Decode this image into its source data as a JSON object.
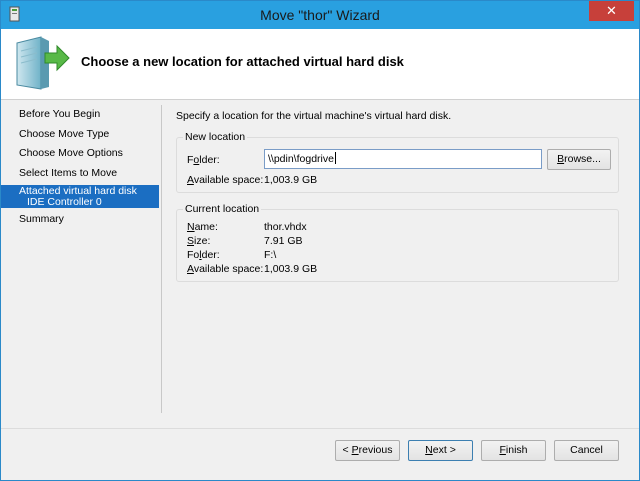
{
  "window": {
    "title": "Move \"thor\" Wizard",
    "close_glyph": "✕"
  },
  "header": {
    "title": "Choose a new location for attached virtual hard disk",
    "icon": "server-move-icon"
  },
  "nav": {
    "items": [
      {
        "label": "Before You Begin"
      },
      {
        "label": "Choose Move Type"
      },
      {
        "label": "Choose Move Options"
      },
      {
        "label": "Select Items to Move"
      },
      {
        "label": "Attached virtual hard disk",
        "sublabel": "IDE Controller 0",
        "selected": true
      },
      {
        "label": "Summary"
      }
    ]
  },
  "main": {
    "description": "Specify a location for the virtual machine's virtual hard disk.",
    "new_location": {
      "group_label": "New location",
      "folder_label_pre": "F",
      "folder_label_u": "o",
      "folder_label_post": "lder:",
      "folder_value": "\\\\pdin\\fogdrive",
      "browse_label_u": "B",
      "browse_label_post": "rowse...",
      "space_label_pre": "",
      "space_label_u": "A",
      "space_label_post": "vailable space:",
      "space_value": "1,003.9 GB"
    },
    "current_location": {
      "group_label": "Current location",
      "name_label_u": "N",
      "name_label_post": "ame:",
      "name_value": "thor.vhdx",
      "size_label_u": "S",
      "size_label_post": "ize:",
      "size_value": "7.91 GB",
      "folder_label_pre": "Fo",
      "folder_label_u": "l",
      "folder_label_post": "der:",
      "folder_value": "F:\\",
      "space_label_u": "A",
      "space_label_post": "vailable space:",
      "space_value": "1,003.9 GB"
    }
  },
  "buttons": {
    "previous_pre": "< ",
    "previous_u": "P",
    "previous_post": "revious",
    "next_u": "N",
    "next_post": "ext >",
    "finish_u": "F",
    "finish_post": "inish",
    "cancel": "Cancel"
  },
  "colors": {
    "titlebar": "#29a0e0",
    "selection": "#1b6ec2",
    "close": "#c7403a"
  }
}
